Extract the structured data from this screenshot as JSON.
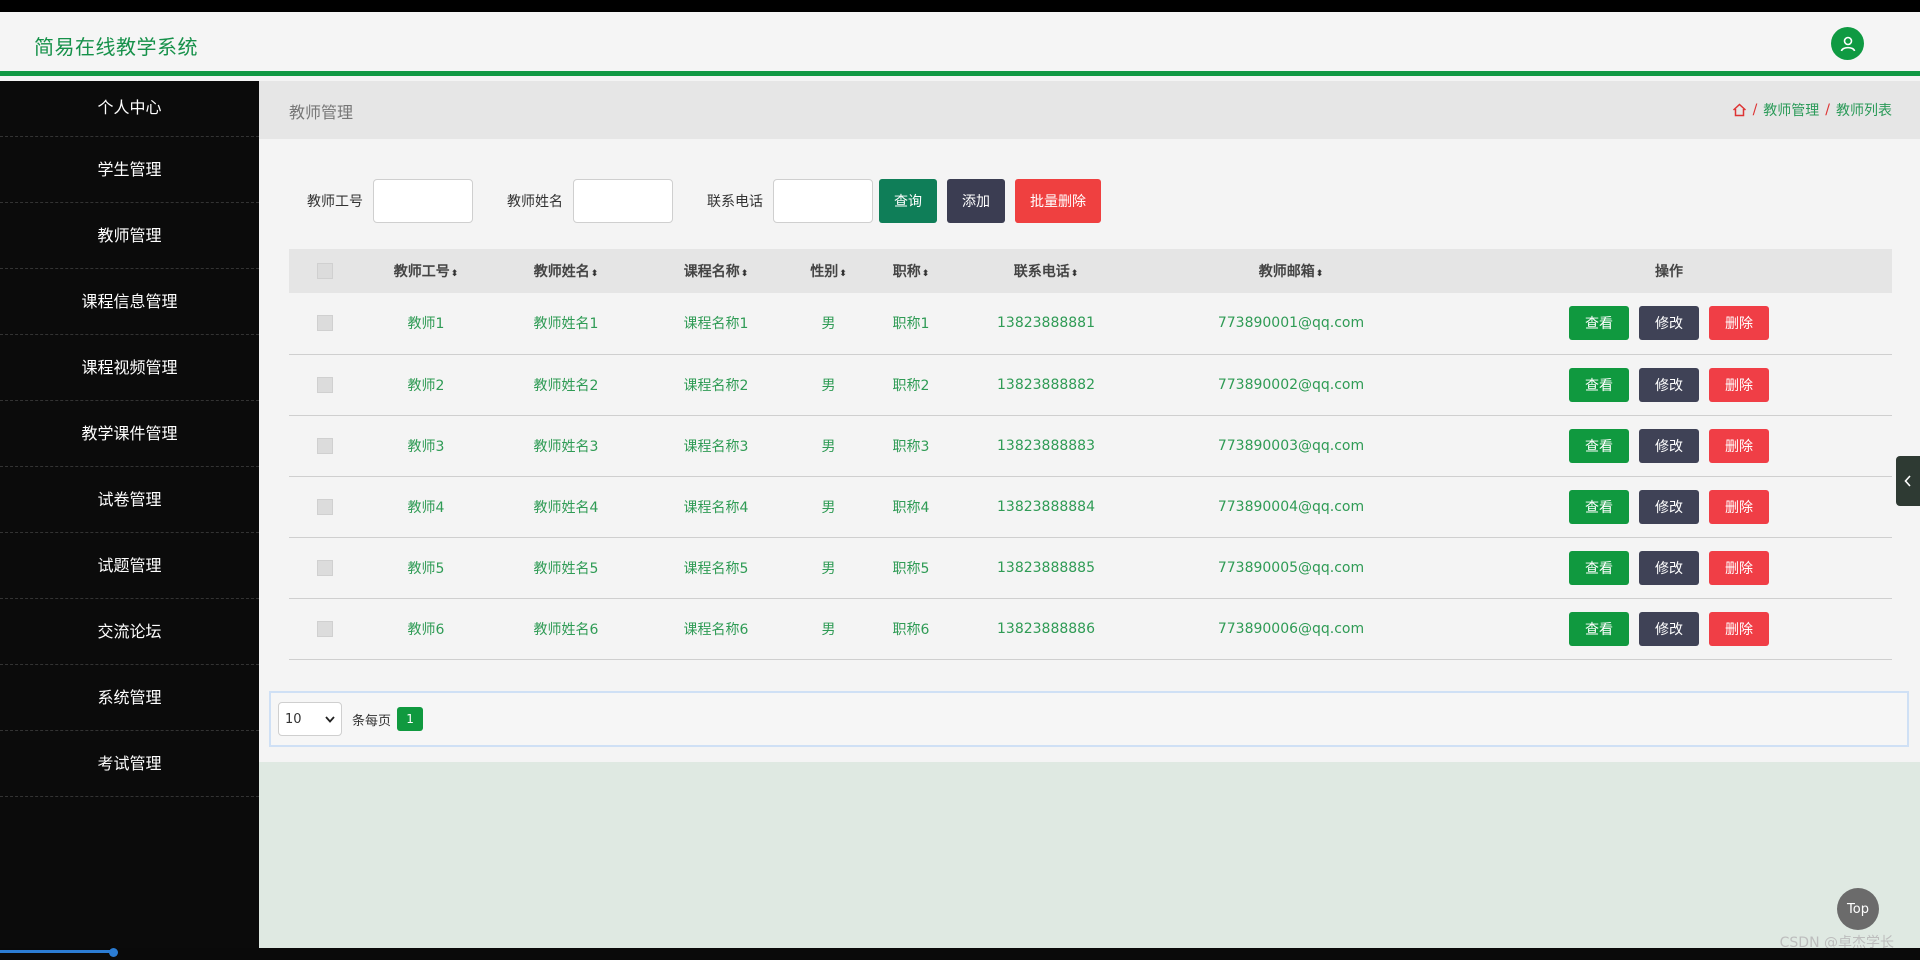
{
  "header": {
    "title": "简易在线教学系统"
  },
  "sidebar": {
    "items": [
      {
        "label": "个人中心"
      },
      {
        "label": "学生管理"
      },
      {
        "label": "教师管理"
      },
      {
        "label": "课程信息管理"
      },
      {
        "label": "课程视频管理"
      },
      {
        "label": "教学课件管理"
      },
      {
        "label": "试卷管理"
      },
      {
        "label": "试题管理"
      },
      {
        "label": "交流论坛"
      },
      {
        "label": "系统管理"
      },
      {
        "label": "考试管理"
      }
    ]
  },
  "page": {
    "title": "教师管理",
    "breadcrumb": [
      "教师管理",
      "教师列表"
    ],
    "separator": "/"
  },
  "search": {
    "fields": [
      {
        "label": "教师工号",
        "value": ""
      },
      {
        "label": "教师姓名",
        "value": ""
      },
      {
        "label": "联系电话",
        "value": ""
      }
    ],
    "query_label": "查询",
    "add_label": "添加",
    "batch_delete_label": "批量删除"
  },
  "table": {
    "columns": [
      "教师工号",
      "教师姓名",
      "课程名称",
      "性别",
      "职称",
      "联系电话",
      "教师邮箱",
      "操作"
    ],
    "sort_icon": "⬍",
    "rows": [
      {
        "id": "教师1",
        "name": "教师姓名1",
        "course": "课程名称1",
        "gender": "男",
        "title": "职称1",
        "phone": "13823888881",
        "email": "773890001@qq.com"
      },
      {
        "id": "教师2",
        "name": "教师姓名2",
        "course": "课程名称2",
        "gender": "男",
        "title": "职称2",
        "phone": "13823888882",
        "email": "773890002@qq.com"
      },
      {
        "id": "教师3",
        "name": "教师姓名3",
        "course": "课程名称3",
        "gender": "男",
        "title": "职称3",
        "phone": "13823888883",
        "email": "773890003@qq.com"
      },
      {
        "id": "教师4",
        "name": "教师姓名4",
        "course": "课程名称4",
        "gender": "男",
        "title": "职称4",
        "phone": "13823888884",
        "email": "773890004@qq.com"
      },
      {
        "id": "教师5",
        "name": "教师姓名5",
        "course": "课程名称5",
        "gender": "男",
        "title": "职称5",
        "phone": "13823888885",
        "email": "773890005@qq.com"
      },
      {
        "id": "教师6",
        "name": "教师姓名6",
        "course": "课程名称6",
        "gender": "男",
        "title": "职称6",
        "phone": "13823888886",
        "email": "773890006@qq.com"
      }
    ],
    "actions": {
      "view": "查看",
      "edit": "修改",
      "delete": "删除"
    }
  },
  "pager": {
    "page_size": "10",
    "per_page_label": "条每页",
    "current_page": "1"
  },
  "misc": {
    "top_label": "Top",
    "watermark": "CSDN @卓杰学长"
  },
  "colors": {
    "accent": "#119944",
    "text_green": "#2f9b55",
    "danger": "#ef4040",
    "dark": "#3b3d52"
  }
}
